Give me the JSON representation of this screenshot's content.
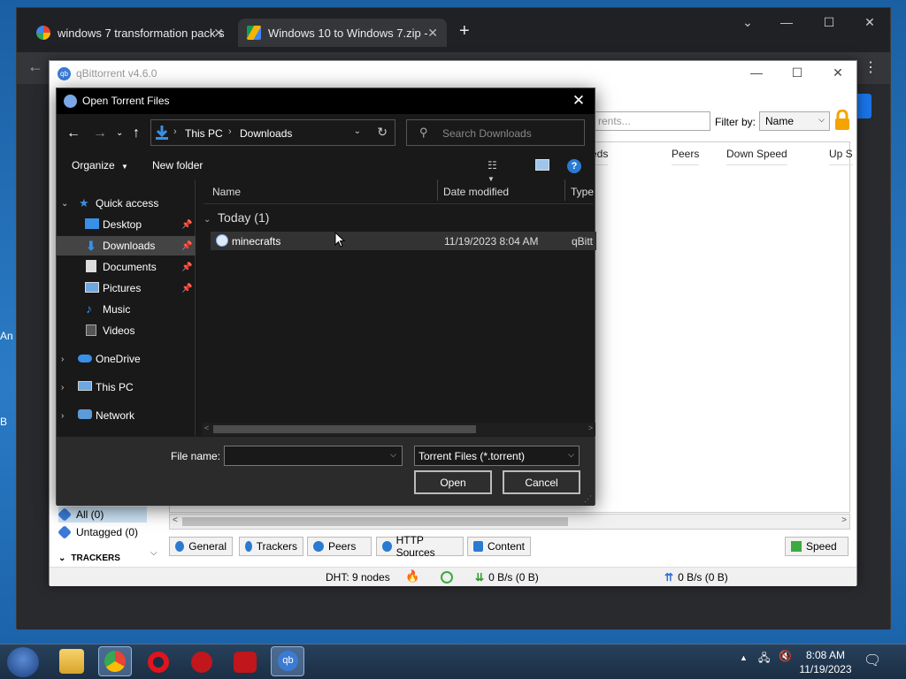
{
  "desktop": {
    "edge_texts": [
      "An",
      "B"
    ]
  },
  "chrome": {
    "tabs": [
      {
        "title": "windows 7 transformation pack s",
        "icon": "google-icon"
      },
      {
        "title": "Windows 10 to Windows 7.zip - ",
        "icon": "google-drive-icon"
      }
    ],
    "new_tab": "+"
  },
  "qbittorrent": {
    "title": "qBittorrent v4.6.0",
    "search_placeholder": "rents...",
    "filter_label": "Filter by:",
    "filter_value": "Name",
    "columns": [
      "eds",
      "Peers",
      "Down Speed",
      "Up S"
    ],
    "sidebar": {
      "all": "All (0)",
      "untagged": "Untagged (0)",
      "trackers_header": "TRACKERS"
    },
    "bottom_tabs": [
      "General",
      "Trackers",
      "Peers",
      "HTTP Sources",
      "Content"
    ],
    "speed_tab": "Speed",
    "status": {
      "dht": "DHT: 9 nodes",
      "down": "0 B/s (0 B)",
      "up": "0 B/s (0 B)"
    }
  },
  "dialog": {
    "title": "Open Torrent Files",
    "breadcrumb": [
      "This PC",
      "Downloads"
    ],
    "search_placeholder": "Search Downloads",
    "toolbar": {
      "organize": "Organize",
      "new_folder": "New folder"
    },
    "nav": [
      {
        "label": "Quick access",
        "icon": "star-icon"
      },
      {
        "label": "Desktop",
        "icon": "desktop-icon",
        "pinned": true
      },
      {
        "label": "Downloads",
        "icon": "downloads-icon",
        "pinned": true,
        "selected": true
      },
      {
        "label": "Documents",
        "icon": "documents-icon",
        "pinned": true
      },
      {
        "label": "Pictures",
        "icon": "pictures-icon",
        "pinned": true
      },
      {
        "label": "Music",
        "icon": "music-icon"
      },
      {
        "label": "Videos",
        "icon": "videos-icon"
      },
      {
        "label": "OneDrive",
        "icon": "onedrive-icon"
      },
      {
        "label": "This PC",
        "icon": "pc-icon"
      },
      {
        "label": "Network",
        "icon": "network-icon"
      }
    ],
    "columns": {
      "name": "Name",
      "date": "Date modified",
      "type": "Type"
    },
    "group": "Today (1)",
    "files": [
      {
        "name": "minecrafts",
        "date": "11/19/2023 8:04 AM",
        "type": "qBitt"
      }
    ],
    "file_name_label": "File name:",
    "file_name_value": "",
    "file_type": "Torrent Files (*.torrent)",
    "open_button": "Open",
    "cancel_button": "Cancel"
  },
  "taskbar": {
    "time": "8:08 AM",
    "date": "11/19/2023"
  }
}
